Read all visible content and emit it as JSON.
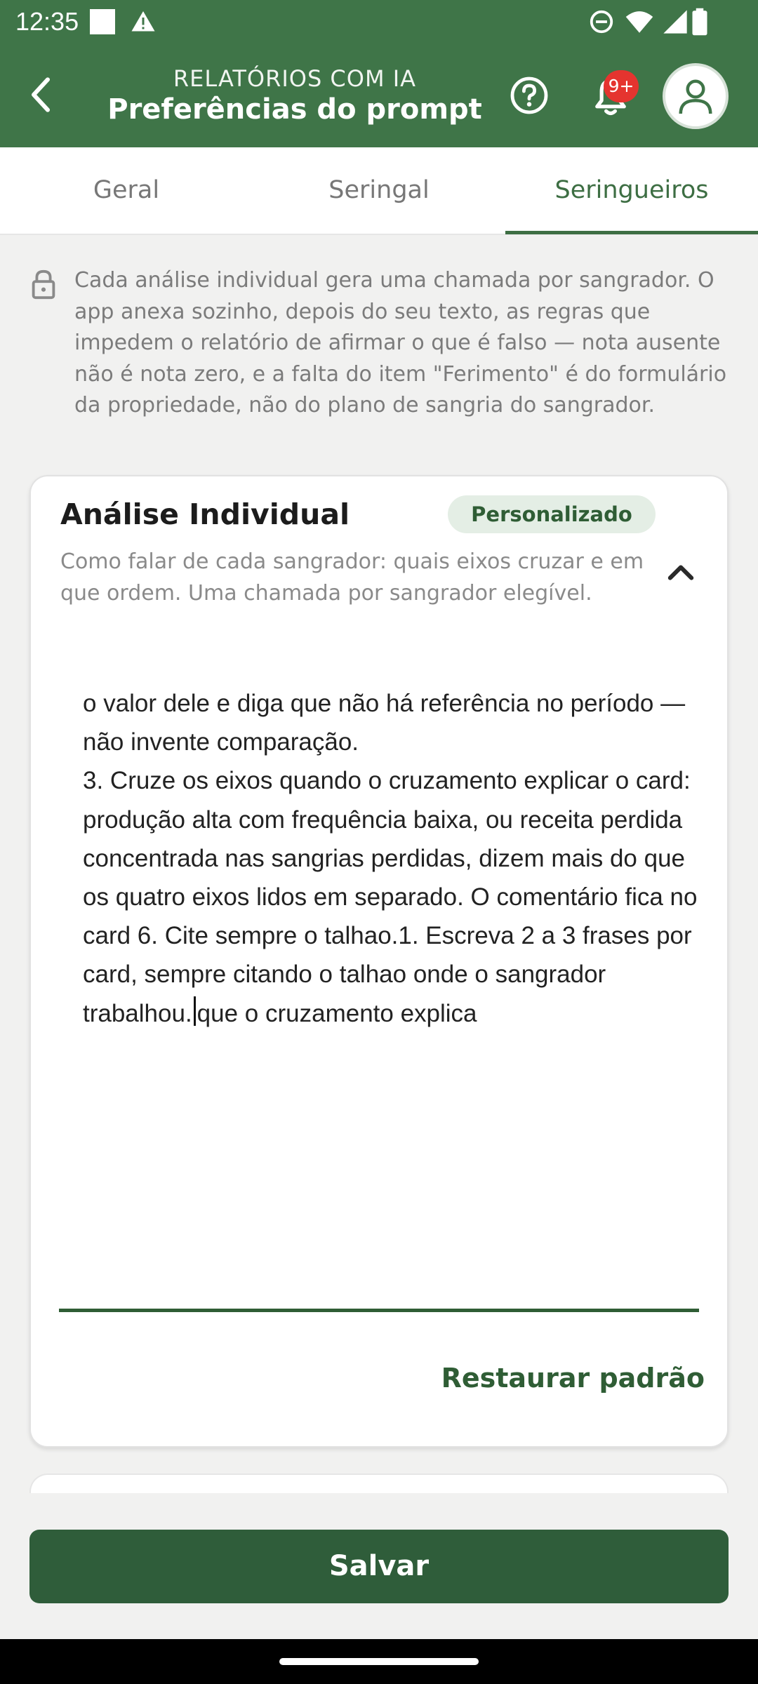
{
  "status_bar": {
    "time": "12:35",
    "icons": [
      "notification-square-icon",
      "warning-icon",
      "do-not-disturb-icon",
      "wifi-icon",
      "signal-icon",
      "battery-icon"
    ]
  },
  "header": {
    "overline": "RELATÓRIOS COM IA",
    "title": "Preferências do prompt",
    "notification_badge": "9+"
  },
  "tabs": [
    {
      "label": "Geral",
      "active": false
    },
    {
      "label": "Seringal",
      "active": false
    },
    {
      "label": "Seringueiros",
      "active": true
    }
  ],
  "info": {
    "text": "Cada análise individual gera uma chamada por sangrador. O app anexa sozinho, depois do seu texto, as regras que impedem o relatório de afirmar o que é falso — nota ausente não é nota zero, e a falta do item \"Ferimento\" é do formulário da propriedade, não do plano de sangria do sangrador."
  },
  "card": {
    "title": "Análise Individual",
    "chip": "Personalizado",
    "description": "Como falar de cada sangrador: quais eixos cruzar e em que ordem. Uma chamada por sangrador elegível.",
    "textarea_before_caret": "execução, qualidade e receita) nas duas lentes (o mês de referência e a safra acumulada).\n2. Em cada eixo, compare o sangrador com a META e com a MÉDIA DA PROPRIEDADE quando esses números existirem. Sem meta ou sem média, descreva o valor dele e diga que não há referência no período — não invente comparação.\n3. Cruze os eixos quando o cruzamento explicar o card: produção alta com frequência baixa, ou receita perdida concentrada nas sangrias perdidas, dizem mais do que os quatro eixos lidos em separado. O comentário fica no card 6. Cite sempre o talhao.1. Escreva 2 a 3 frases por card, sempre citando o talhao onde o sangrador trabalhou.",
    "textarea_after_caret": "que o cruzamento explica",
    "restore_label": "Restaurar padrão"
  },
  "footer": {
    "save_label": "Salvar"
  },
  "colors": {
    "header": "#3f7548",
    "accent": "#2f5d35",
    "button": "#2f5d3a",
    "badge": "#e5342f"
  }
}
